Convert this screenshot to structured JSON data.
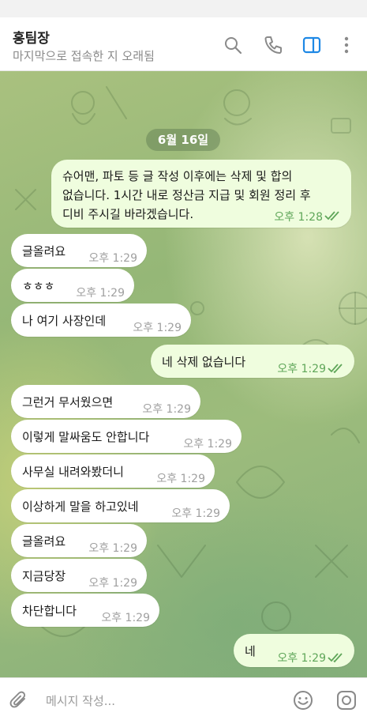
{
  "header": {
    "title": "홍팀장",
    "status": "마지막으로 접속한 지 오래됨",
    "icons": [
      "search-icon",
      "phone-icon",
      "sidebar-panel-icon",
      "more-vertical-icon"
    ],
    "accent_color": "#1e88e5"
  },
  "chat": {
    "date_label": "6월 16일",
    "first_message": {
      "lines": [
        "슈어맨, 파토 등 글 작성 이후에는 삭제 및 합의",
        "없습니다. 1시간 내로 정산금 지급 및 회원 정리 후",
        "디비 주시길 바라겠습니다."
      ],
      "time": "오후 1:28",
      "direction": "out",
      "status": "read"
    },
    "messages": [
      {
        "text": "글올려요",
        "time": "오후 1:29",
        "direction": "in"
      },
      {
        "text": "ㅎㅎㅎ",
        "time": "오후 1:29",
        "direction": "in"
      },
      {
        "text": "나 여기 사장인데",
        "time": "오후 1:29",
        "direction": "in"
      },
      {
        "text": "네 삭제 없습니다",
        "time": "오후 1:29",
        "direction": "out",
        "status": "read"
      },
      {
        "text": "그런거 무서웠으면",
        "time": "오후 1:29",
        "direction": "in"
      },
      {
        "text": "이렇게 말싸움도 안합니다",
        "time": "오후 1:29",
        "direction": "in"
      },
      {
        "text": "사무실 내려와봤더니",
        "time": "오후 1:29",
        "direction": "in"
      },
      {
        "text": "이상하게 말을 하고있네",
        "time": "오후 1:29",
        "direction": "in"
      },
      {
        "text": "글올려요",
        "time": "오후 1:29",
        "direction": "in"
      },
      {
        "text": "지금당장",
        "time": "오후 1:29",
        "direction": "in"
      },
      {
        "text": "차단합니다",
        "time": "오후 1:29",
        "direction": "in"
      },
      {
        "text": "네",
        "time": "오후 1:29",
        "direction": "out",
        "status": "read"
      }
    ]
  },
  "input": {
    "placeholder": "메시지 작성...",
    "icons": [
      "attach-icon",
      "emoji-icon",
      "camera-icon"
    ]
  },
  "colors": {
    "outgoing_bubble": "#effdde",
    "incoming_bubble": "#ffffff",
    "read_check": "#5fa659"
  }
}
